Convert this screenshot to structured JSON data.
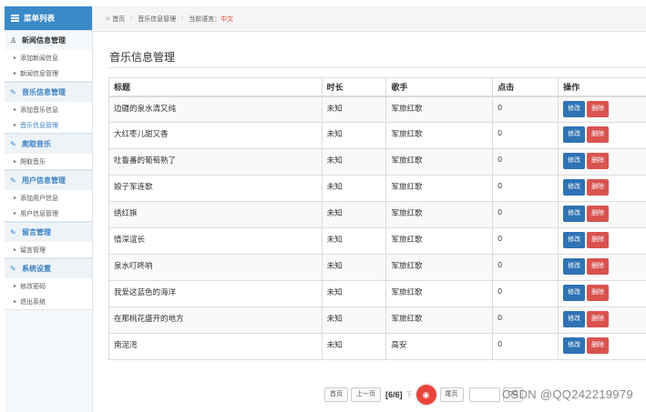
{
  "sidebar": {
    "header": "菜单列表",
    "groups": [
      {
        "title": "新闻信息管理",
        "items": [
          "添加新闻信息",
          "新闻信息管理"
        ]
      },
      {
        "title": "音乐信息管理",
        "items": [
          "添加音乐信息",
          "音乐信息管理"
        ]
      },
      {
        "title": "爬取音乐",
        "items": [
          "爬取音乐"
        ]
      },
      {
        "title": "用户信息管理",
        "items": [
          "添加用户信息",
          "用户信息管理"
        ]
      },
      {
        "title": "留言管理",
        "items": [
          "留言管理"
        ]
      },
      {
        "title": "系统设置",
        "items": [
          "修改密码",
          "退出系统"
        ]
      }
    ]
  },
  "breadcrumb": {
    "home": "首页",
    "current": "音乐信息管理",
    "lang_label": "当前语言：",
    "lang_value": "中文"
  },
  "page_title": "音乐信息管理",
  "table": {
    "headers": [
      "标题",
      "时长",
      "歌手",
      "点击",
      "操作"
    ],
    "rows": [
      {
        "title": "边疆的泉水清又纯",
        "duration": "未知",
        "singer": "军旅红歌",
        "clicks": "0"
      },
      {
        "title": "大红枣儿甜又香",
        "duration": "未知",
        "singer": "军旅红歌",
        "clicks": "0"
      },
      {
        "title": "吐鲁番的葡萄熟了",
        "duration": "未知",
        "singer": "军旅红歌",
        "clicks": "0"
      },
      {
        "title": "娘子军连歌",
        "duration": "未知",
        "singer": "军旅红歌",
        "clicks": "0"
      },
      {
        "title": "绣红旗",
        "duration": "未知",
        "singer": "军旅红歌",
        "clicks": "0"
      },
      {
        "title": "情深谊长",
        "duration": "未知",
        "singer": "军旅红歌",
        "clicks": "0"
      },
      {
        "title": "泉水叮咚响",
        "duration": "未知",
        "singer": "军旅红歌",
        "clicks": "0"
      },
      {
        "title": "我爱这蓝色的海洋",
        "duration": "未知",
        "singer": "军旅红歌",
        "clicks": "0"
      },
      {
        "title": "在那桃花盛开的地方",
        "duration": "未知",
        "singer": "军旅红歌",
        "clicks": "0"
      },
      {
        "title": "南泥湾",
        "duration": "未知",
        "singer": "高安",
        "clicks": "0"
      }
    ],
    "edit_label": "修改",
    "delete_label": "删除"
  },
  "pager": {
    "first": "首页",
    "prev": "上一页",
    "current": "[6/6]",
    "next_hidden": "下",
    "last": "尾页",
    "go": "GO"
  },
  "watermark": "CSDN @QQ242219979",
  "colors": {
    "header_blue": "#3a8ac8",
    "edit_blue": "#2f73b5",
    "delete_red": "#d9534f"
  }
}
